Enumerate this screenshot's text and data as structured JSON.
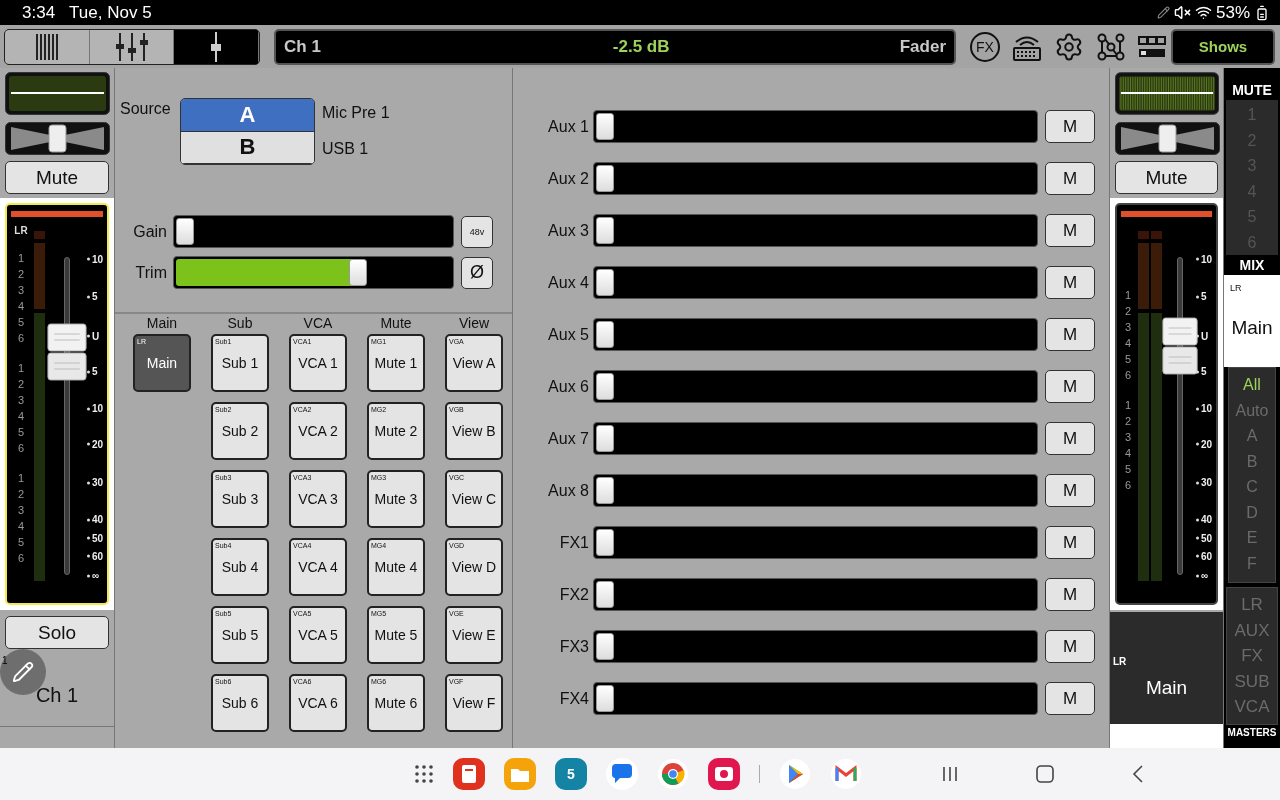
{
  "status_bar": {
    "time": "3:34",
    "date": "Tue, Nov 5",
    "battery": "53%"
  },
  "toolbar": {
    "modes": [
      {
        "kind": "mixer",
        "selected": false
      },
      {
        "kind": "bank",
        "selected": false
      },
      {
        "kind": "fader",
        "selected": true
      }
    ],
    "display": {
      "channel": "Ch 1",
      "value": "-2.5 dB",
      "mode": "Fader"
    },
    "fx": "FX",
    "shows": "Shows"
  },
  "channel_strip": {
    "selected": true,
    "mute": "Mute",
    "bus": "LR",
    "groups": [
      [
        "1",
        "2",
        "3",
        "4",
        "5",
        "6"
      ],
      [
        "1",
        "2",
        "3",
        "4",
        "5",
        "6"
      ],
      [
        "1",
        "2",
        "3",
        "4",
        "5",
        "6"
      ]
    ],
    "scale": [
      "10",
      "5",
      "U",
      "5",
      "10",
      "20",
      "30",
      "40",
      "50",
      "60",
      "∞"
    ],
    "fader": {
      "level": 0.7
    },
    "solo": "Solo",
    "number": "1",
    "name": "Ch 1"
  },
  "source": {
    "label": "Source",
    "options": [
      {
        "letter": "A",
        "name": "Mic Pre 1",
        "selected": true
      },
      {
        "letter": "B",
        "name": "USB 1",
        "selected": false
      }
    ]
  },
  "gain": {
    "label": "Gain",
    "level": 0.0,
    "phantom": "48v"
  },
  "trim": {
    "label": "Trim",
    "level": 0.66,
    "polarity": "Ø"
  },
  "assign": [
    {
      "title": "Main",
      "buttons": [
        {
          "tag": "LR",
          "label": "Main",
          "selected": true
        }
      ]
    },
    {
      "title": "Sub",
      "buttons": [
        {
          "tag": "Sub1",
          "label": "Sub 1",
          "selected": false
        },
        {
          "tag": "Sub2",
          "label": "Sub 2",
          "selected": false
        },
        {
          "tag": "Sub3",
          "label": "Sub 3",
          "selected": false
        },
        {
          "tag": "Sub4",
          "label": "Sub 4",
          "selected": false
        },
        {
          "tag": "Sub5",
          "label": "Sub 5",
          "selected": false
        },
        {
          "tag": "Sub6",
          "label": "Sub 6",
          "selected": false
        }
      ]
    },
    {
      "title": "VCA",
      "buttons": [
        {
          "tag": "VCA1",
          "label": "VCA 1",
          "selected": false
        },
        {
          "tag": "VCA2",
          "label": "VCA 2",
          "selected": false
        },
        {
          "tag": "VCA3",
          "label": "VCA 3",
          "selected": false
        },
        {
          "tag": "VCA4",
          "label": "VCA 4",
          "selected": false
        },
        {
          "tag": "VCA5",
          "label": "VCA 5",
          "selected": false
        },
        {
          "tag": "VCA6",
          "label": "VCA 6",
          "selected": false
        }
      ]
    },
    {
      "title": "Mute",
      "buttons": [
        {
          "tag": "MG1",
          "label": "Mute 1",
          "selected": false
        },
        {
          "tag": "MG2",
          "label": "Mute 2",
          "selected": false
        },
        {
          "tag": "MG3",
          "label": "Mute 3",
          "selected": false
        },
        {
          "tag": "MG4",
          "label": "Mute 4",
          "selected": false
        },
        {
          "tag": "MG5",
          "label": "Mute 5",
          "selected": false
        },
        {
          "tag": "MG6",
          "label": "Mute 6",
          "selected": false
        }
      ]
    },
    {
      "title": "View",
      "buttons": [
        {
          "tag": "VGA",
          "label": "View A",
          "selected": false
        },
        {
          "tag": "VGB",
          "label": "View B",
          "selected": false
        },
        {
          "tag": "VGC",
          "label": "View C",
          "selected": false
        },
        {
          "tag": "VGD",
          "label": "View D",
          "selected": false
        },
        {
          "tag": "VGE",
          "label": "View E",
          "selected": false
        },
        {
          "tag": "VGF",
          "label": "View F",
          "selected": false
        }
      ]
    }
  ],
  "sends": [
    {
      "label": "Aux 1",
      "level": 0.0,
      "mute": "M",
      "muted": false
    },
    {
      "label": "Aux 2",
      "level": 0.0,
      "mute": "M",
      "muted": false
    },
    {
      "label": "Aux 3",
      "level": 0.0,
      "mute": "M",
      "muted": false
    },
    {
      "label": "Aux 4",
      "level": 0.0,
      "mute": "M",
      "muted": false
    },
    {
      "label": "Aux 5",
      "level": 0.0,
      "mute": "M",
      "muted": false
    },
    {
      "label": "Aux 6",
      "level": 0.0,
      "mute": "M",
      "muted": false
    },
    {
      "label": "Aux 7",
      "level": 0.0,
      "mute": "M",
      "muted": false
    },
    {
      "label": "Aux 8",
      "level": 0.0,
      "mute": "M",
      "muted": false
    },
    {
      "label": "FX1",
      "level": 0.0,
      "mute": "M",
      "muted": false
    },
    {
      "label": "FX2",
      "level": 0.0,
      "mute": "M",
      "muted": false
    },
    {
      "label": "FX3",
      "level": 0.0,
      "mute": "M",
      "muted": false
    },
    {
      "label": "FX4",
      "level": 0.0,
      "mute": "M",
      "muted": false
    }
  ],
  "master_strip": {
    "selected": false,
    "mute": "Mute",
    "groups": [
      [
        "1",
        "2",
        "3",
        "4",
        "5",
        "6"
      ],
      [
        "1",
        "2",
        "3",
        "4",
        "5",
        "6"
      ]
    ],
    "scale": [
      "10",
      "5",
      "U",
      "5",
      "10",
      "20",
      "30",
      "40",
      "50",
      "60",
      "∞"
    ],
    "fader": {
      "level": 0.72
    },
    "bus": "LR",
    "name": "Main"
  },
  "sidebar": {
    "mute_title": "MUTE",
    "mute_groups": [
      "1",
      "2",
      "3",
      "4",
      "5",
      "6"
    ],
    "mix_title": "MIX",
    "mix_bus": "LR",
    "mix_name": "Main",
    "views": [
      {
        "label": "All",
        "selected": true
      },
      {
        "label": "Auto",
        "selected": false
      },
      {
        "label": "A",
        "selected": false
      },
      {
        "label": "B",
        "selected": false
      },
      {
        "label": "C",
        "selected": false
      },
      {
        "label": "D",
        "selected": false
      },
      {
        "label": "E",
        "selected": false
      },
      {
        "label": "F",
        "selected": false
      }
    ],
    "masters": [
      {
        "label": "LR",
        "selected": false
      },
      {
        "label": "AUX",
        "selected": false
      },
      {
        "label": "FX",
        "selected": false
      },
      {
        "label": "SUB",
        "selected": false
      },
      {
        "label": "VCA",
        "selected": false
      }
    ],
    "masters_title": "MASTERS"
  },
  "dock": {
    "calendar_day": "5"
  }
}
